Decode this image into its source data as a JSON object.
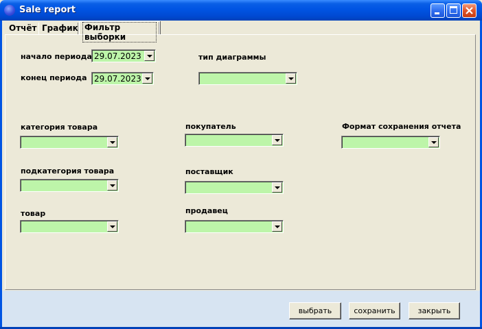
{
  "window": {
    "title": "Sale report"
  },
  "tabs": [
    {
      "label": "Отчёт"
    },
    {
      "label": "График"
    },
    {
      "label": "Фильтр выборки"
    }
  ],
  "period": {
    "start_label": "начало периода",
    "start_value": "29.07.2023",
    "end_label": "конец периода",
    "end_value": "29.07.2023"
  },
  "chart_type": {
    "label": "тип диаграммы",
    "value": ""
  },
  "filters": {
    "product_category": {
      "label": "категория товара",
      "value": ""
    },
    "product_subcategory": {
      "label": "подкатегория товара",
      "value": ""
    },
    "product": {
      "label": "товар",
      "value": ""
    },
    "buyer": {
      "label": "покупатель",
      "value": ""
    },
    "supplier": {
      "label": "поставщик",
      "value": ""
    },
    "seller": {
      "label": "продавец",
      "value": ""
    },
    "save_format": {
      "label": "Формат сохранения отчета",
      "value": ""
    }
  },
  "buttons": {
    "select": "выбрать",
    "save": "сохранить",
    "close": "закрыть"
  },
  "colors": {
    "combo_background": "#BDF5A9",
    "titlebar": "#0054E3",
    "window_background": "#ECE9D8"
  }
}
